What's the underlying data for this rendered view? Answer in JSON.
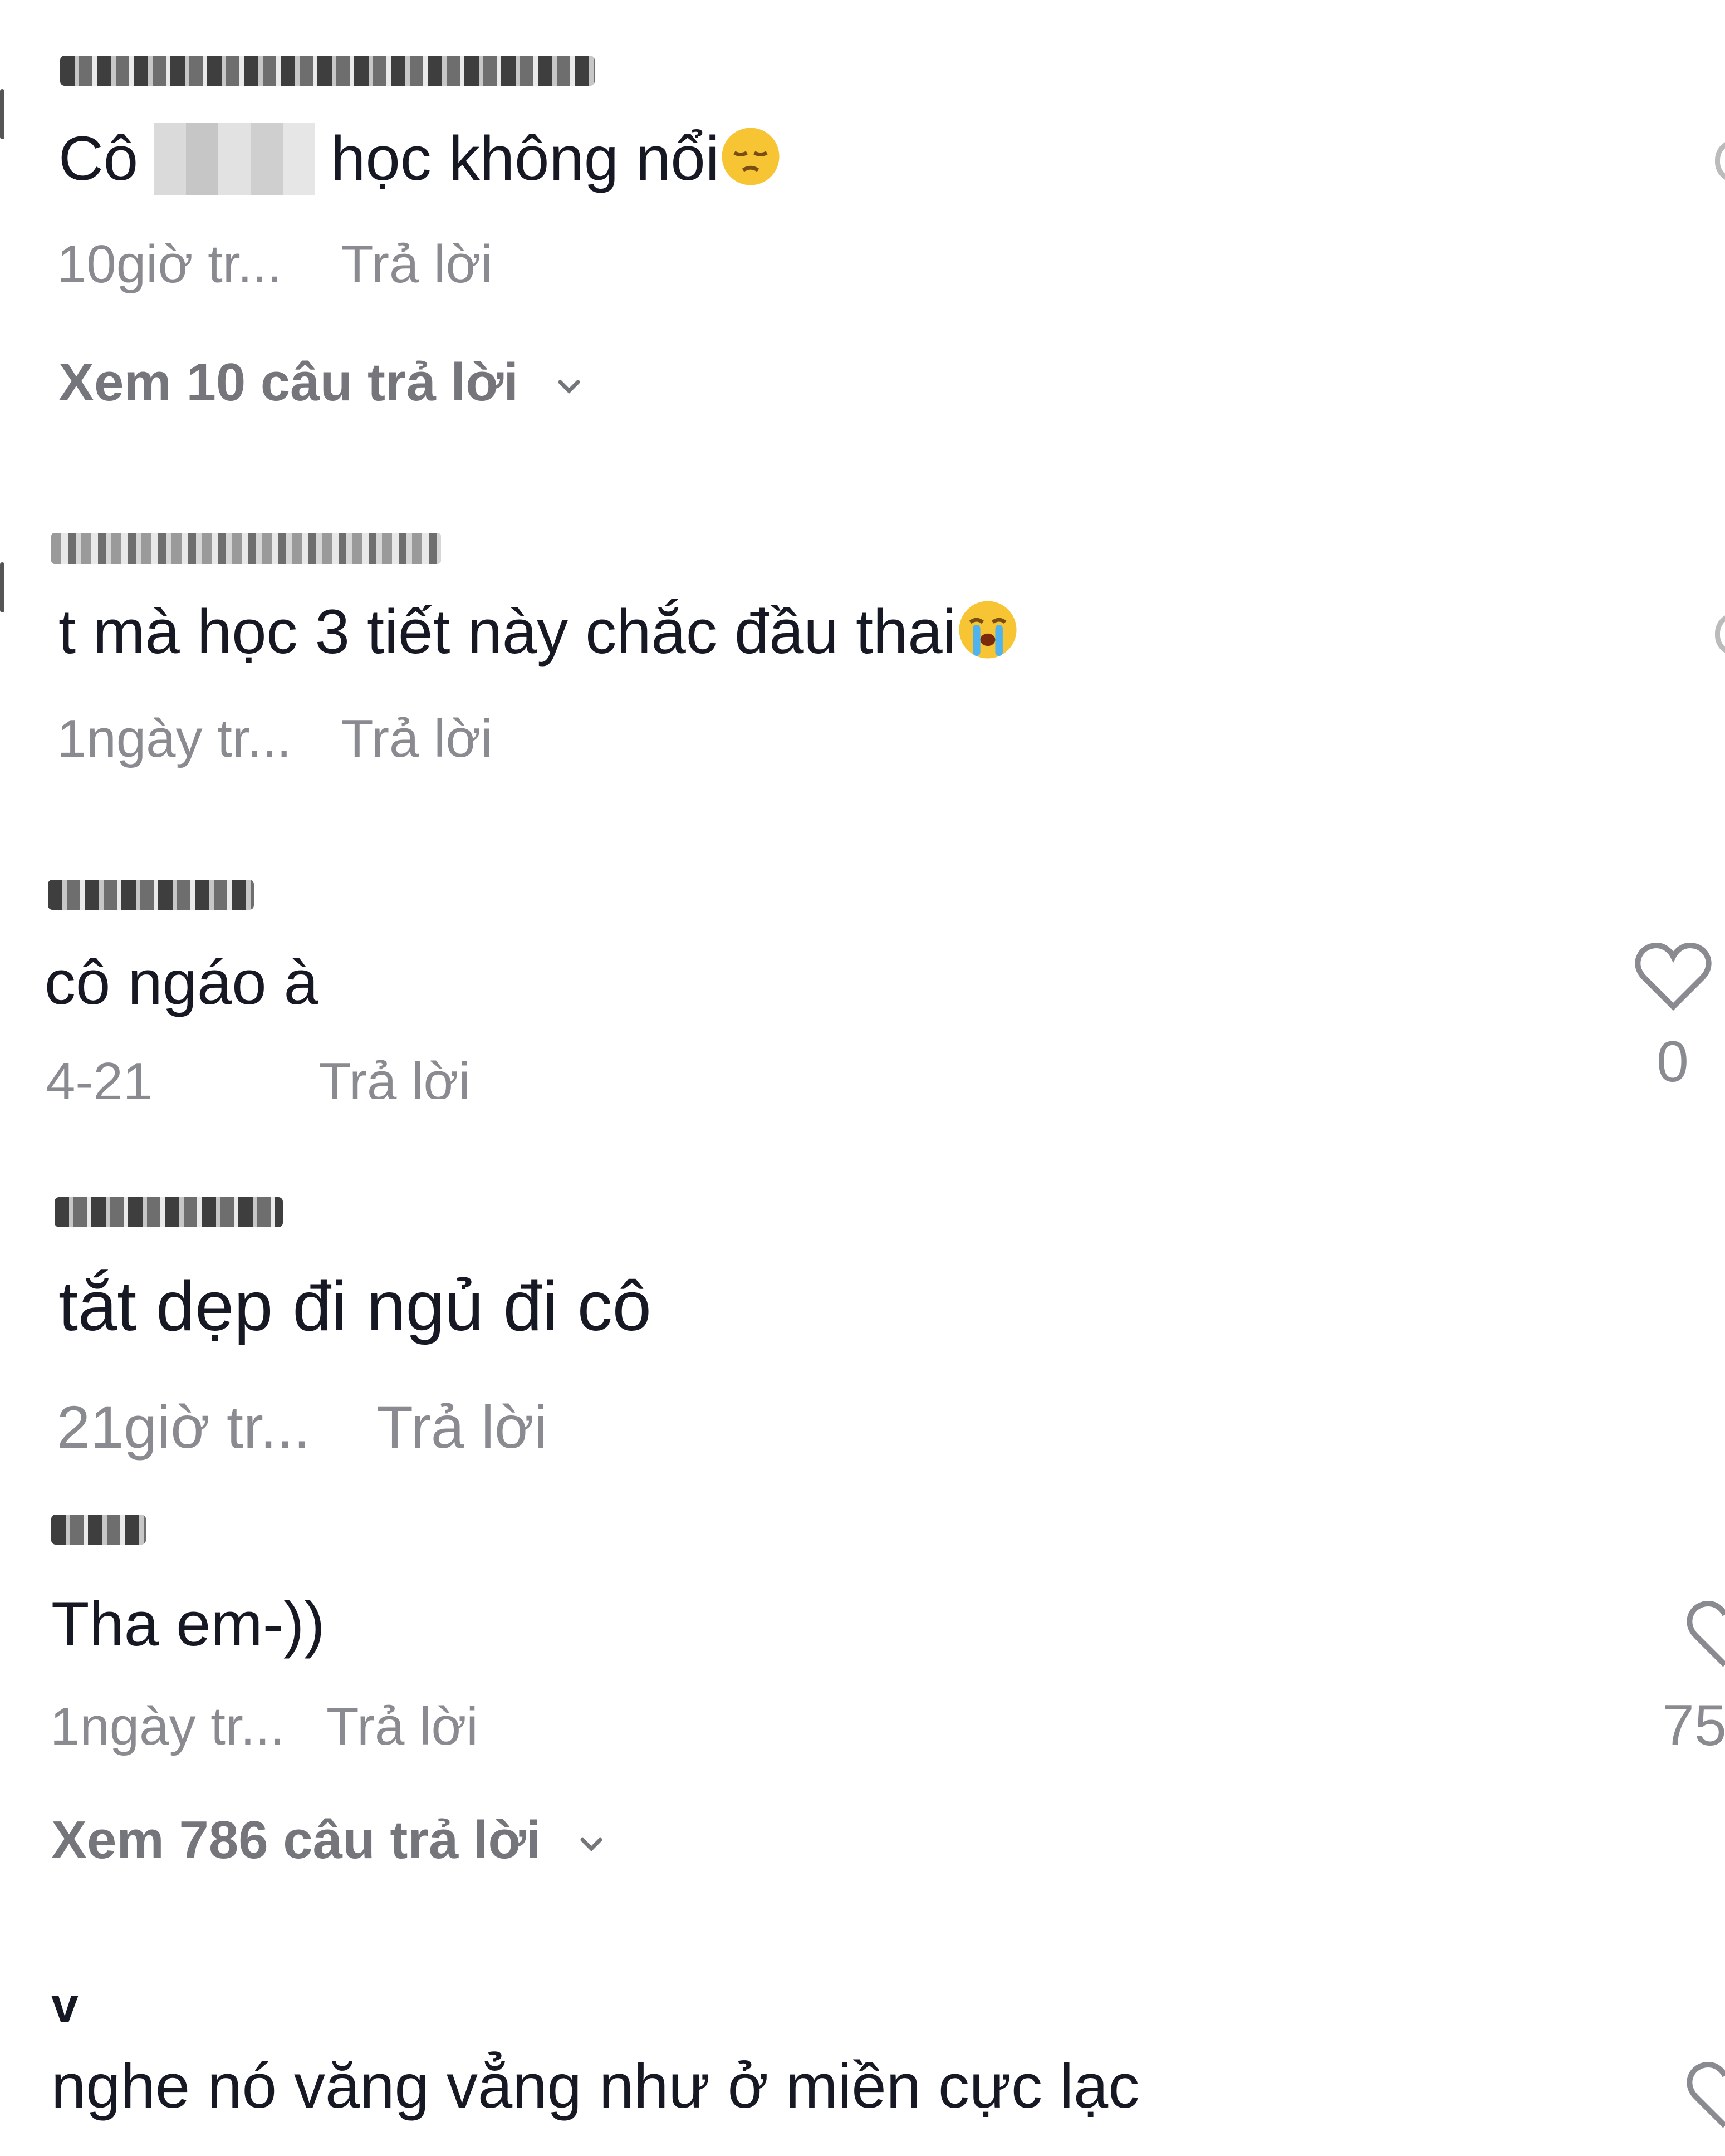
{
  "comments": [
    {
      "text_before": "Cô",
      "text_after": "học không nổi",
      "emoji": "pensive-face-emoji",
      "time": "10giờ tr...",
      "reply": "Trả lời",
      "view_replies": "Xem 10 câu trả lời"
    },
    {
      "text": "t mà học 3 tiết này chắc đầu thai",
      "emoji": "loudly-crying-face-emoji",
      "time": "1ngày tr...",
      "reply": "Trả lời"
    },
    {
      "text": "cô ngáo à",
      "time": "4-21",
      "reply": "Trả lời",
      "likes": "0"
    },
    {
      "text": "tắt dẹp đi ngủ đi cô",
      "time": "21giờ tr...",
      "reply": "Trả lời"
    },
    {
      "text": "Tha em-))",
      "time": "1ngày tr...",
      "reply": "Trả lời",
      "likes": "75",
      "view_replies": "Xem 786 câu trả lời"
    },
    {
      "username": "v",
      "text": "nghe nó văng vẳng như ở miền cực lạc"
    }
  ],
  "colors": {
    "text": "#161823",
    "secondary": "#8a8b91",
    "background": "#ffffff"
  }
}
